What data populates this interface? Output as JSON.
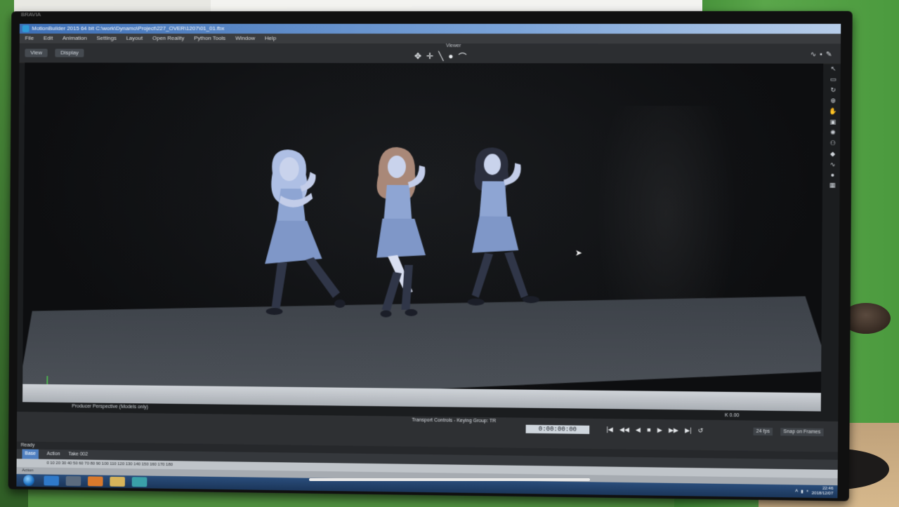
{
  "photo": {
    "bezel_label": "BRAVIA"
  },
  "window": {
    "title": "MotionBuilder 2015   64 bit   C:\\work\\Dynamo\\Project\\227_OVER\\1207\\01_01.fbx"
  },
  "menu": [
    "File",
    "Edit",
    "Animation",
    "Settings",
    "Layout",
    "Open Reality",
    "Python Tools",
    "Window",
    "Help"
  ],
  "viewer": {
    "label": "Viewer",
    "view_button": "View",
    "display_button": "Display",
    "caption": "Producer Perspective (Models only)",
    "k_field": "K 0.00"
  },
  "transport": {
    "title": "Transport Controls  -  Keying Group: TR",
    "time_display": "0:00:00:00",
    "fps": "24 fps",
    "snap": "Snap on Frames"
  },
  "status": {
    "ready": "Ready"
  },
  "anim_bar": {
    "items": [
      "Base",
      "Action",
      "Take 002"
    ]
  },
  "timeline": {
    "ticks": "0     10     20     30     40     50     60     70     80     90     100     110     120     130     140     150     160     170     180"
  },
  "taskbar": {
    "clock_time": "22:46",
    "clock_date": "2018/12/07",
    "tray_text": "A"
  },
  "colors": {
    "titlebar": "#3d6fb6",
    "viewport": "#0d0e10",
    "stage": "#4e535a",
    "green_screen": "#4b9a3e"
  }
}
